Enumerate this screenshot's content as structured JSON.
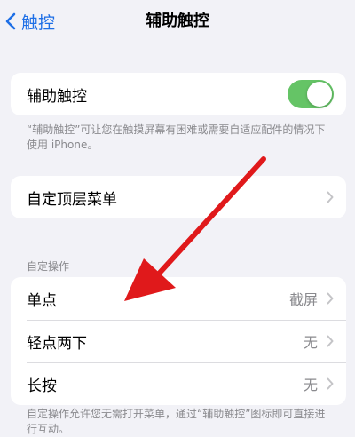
{
  "nav": {
    "back_label": "触控",
    "title": "辅助触控"
  },
  "assistive_touch": {
    "label": "辅助触控",
    "enabled": true,
    "footnote": "“辅助触控”可让您在触摸屏幕有困难或需要自适应配件的情况下使用 iPhone。"
  },
  "custom_top_menu": {
    "label": "自定顶层菜单"
  },
  "custom_actions": {
    "header": "自定操作",
    "items": [
      {
        "label": "单点",
        "value": "截屏"
      },
      {
        "label": "轻点两下",
        "value": "无"
      },
      {
        "label": "长按",
        "value": "无"
      }
    ],
    "footnote": "自定操作允许您无需打开菜单，通过“辅助触控”图标即可直接进行互动。"
  },
  "colors": {
    "accent": "#1e6fe6",
    "toggle_on": "#65c466",
    "annotation_arrow": "#e0191b"
  },
  "icons": {
    "back": "chevron-left-icon",
    "disclosure": "chevron-right-icon",
    "annotation": "red-arrow-annotation"
  }
}
